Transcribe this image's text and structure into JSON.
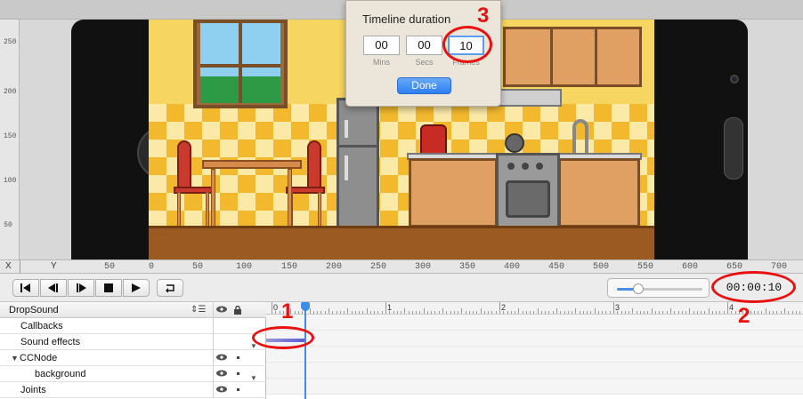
{
  "colors": {
    "accent_blue": "#3d8ee8",
    "annotation_red": "#e8110f",
    "done_button": "#2d7ef0"
  },
  "vertical_ruler": {
    "labels": [
      "250",
      "200",
      "150",
      "100",
      "50"
    ]
  },
  "horizontal_ruler": {
    "x_label": "X",
    "y_label": "Y",
    "labels": [
      "50",
      "0",
      "50",
      "100",
      "150",
      "200",
      "250",
      "300",
      "350",
      "400",
      "450",
      "500",
      "550",
      "600",
      "650",
      "700"
    ]
  },
  "popover": {
    "title": "Timeline duration",
    "mins_value": "00",
    "secs_value": "00",
    "frames_value": "10",
    "mins_label": "Mins",
    "secs_label": "Secs",
    "frames_label": "Frames",
    "done_label": "Done"
  },
  "playback_controls": [
    {
      "name": "jump-to-start-button",
      "icon": "skip-back-icon"
    },
    {
      "name": "step-back-button",
      "icon": "step-back-icon"
    },
    {
      "name": "step-forward-button",
      "icon": "step-forward-icon"
    },
    {
      "name": "stop-button",
      "icon": "stop-icon"
    },
    {
      "name": "play-button",
      "icon": "play-icon"
    },
    {
      "name": "loop-button",
      "icon": "loop-icon"
    }
  ],
  "zoom_slider": {
    "value": 0.25
  },
  "time_display": "00:00:10",
  "timeline": {
    "sequence_name": "DropSound",
    "rows": [
      {
        "label": "Callbacks",
        "indent": 1,
        "visibility": false,
        "expander": false
      },
      {
        "label": "Sound effects",
        "indent": 1,
        "visibility": false,
        "expander": false
      },
      {
        "label": "CCNode",
        "indent": 0,
        "visibility": true,
        "expander": true
      },
      {
        "label": "background",
        "indent": 2,
        "visibility": true,
        "expander": false
      },
      {
        "label": "Joints",
        "indent": 1,
        "visibility": true,
        "expander": false
      }
    ],
    "ruler_labels": [
      "0",
      "1",
      "2",
      "3",
      "4"
    ]
  },
  "annotations": {
    "one": "1",
    "two": "2",
    "three": "3"
  }
}
